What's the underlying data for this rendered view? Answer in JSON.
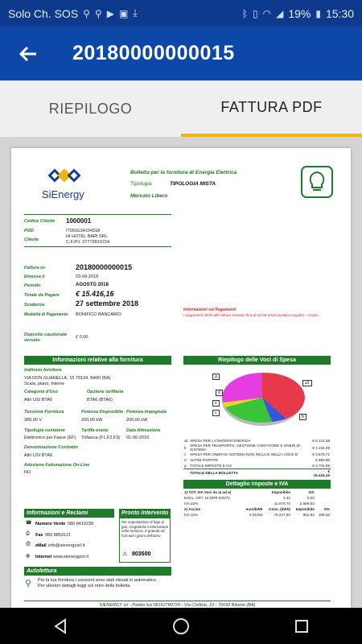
{
  "status": {
    "carrier": "Solo Ch. SOS",
    "battery": "19%",
    "time": "15:30"
  },
  "appbar": {
    "title": "20180000000015"
  },
  "tabs": [
    {
      "label": "RIEPILOGO"
    },
    {
      "label": "FATTURA PDF"
    }
  ],
  "invoice": {
    "brand": "SiEnergy",
    "heading": "Bolletta per la fornitura di Energia Elettrica",
    "tipologia_label": "Tipologia",
    "tipologia_value": "TIPOLOGIA MISTA",
    "mercato": "Mercato Libero",
    "codice_cliente_label": "Codice Cliente",
    "codice_cliente": "1000001",
    "pod_label": "POD",
    "pod": "IT001E34104318",
    "cliente_label": "Cliente",
    "cliente_name": "HI HOTEL BARI SRL",
    "cliente_cf": "C.F./P.I. 07779910724",
    "fattura_label": "Fattura nr.",
    "fattura": "20180000000015",
    "emessa_label": "Emessa il",
    "emessa": "03-09-2018",
    "periodo_label": "Periodo",
    "periodo": "AGOSTO 2018",
    "totale_label": "Totale da Pagare",
    "totale": "€ 15.416,16",
    "scadenza_label": "Scadenza",
    "scadenza": "27 settembre 2018",
    "modalita_label": "Modalità di Pagamento",
    "modalita": "BONIFICO BANCARIO",
    "info_pagamenti_label": "Informazioni sui Pagamenti",
    "info_pagamenti": "I pagamenti riferiti alle fatture emesse fino al 03-09-2018 risultano regolari - Grazie",
    "deposito_label": "Deposito cauzionale versato",
    "deposito": "€  0,00",
    "fornitura_bar": "Informazioni relative alla fornitura",
    "indirizzo_label": "Indirizzo fornitura",
    "indirizzo": "VIA DON GUANELLA, 15 70124, BARI (BA)",
    "indirizzo2": "Scala, piano, interno",
    "categoria_label": "Categoria d'Uso",
    "categoria": "Altri USI BTA6",
    "opzione_label": "Opzione tariffaria",
    "opzione": "BTA6 (BTA6)",
    "tensione_label": "Tensione Fornitura",
    "tensione": "380,00   V",
    "potdisp_label": "Potenza Disponibile",
    "potdisp": "200,00    kW",
    "potimp_label": "Potenza impegnata",
    "potimp": "200,00   kW",
    "contatore_label": "Tipologia contatore",
    "contatore": "Elettronico per Fasce (EF)",
    "tariffa_label": "Tariffa oraria",
    "tariffa": "Trifascia (F1,F2,F3)",
    "attivazione_label": "Data Attivazione",
    "attivazione": "01-06-2016",
    "denominazione_label": "Denominazione Contratto",
    "denominazione": "Altri USI BTA6",
    "adesione_label": "Adesione Fatturazione On-Line",
    "adesione": "NO",
    "riepilogo_bar": "Riepilogo delle Voci di Spesa",
    "pie_labels": [
      "a1",
      "b",
      "c",
      "d",
      "e",
      "g"
    ],
    "voci": [
      {
        "k": "a1",
        "label": "SPESA PER LA MATERIA ENERGIA",
        "v": "€ 6.121,58"
      },
      {
        "k": "b",
        "label": "SPESA PER TRASPORTO, GESTIONE CONTATORE E ONERI DI SISTEMA",
        "v": "€ 1.232,69"
      },
      {
        "k": "c",
        "label": "SPESA PER ONERI DI SISTEMA NON INCLUSI NELLA VOCE B",
        "v": "€ 3.678,71"
      },
      {
        "k": "d",
        "label": "ALTRE PARTITE",
        "v": "€ 650,99"
      },
      {
        "k": "g",
        "label": "TOTALE IMPOSTE E IVA",
        "v": "€ 3.731,99"
      },
      {
        "k": "",
        "label": "TOTALE DELLA BOLLETTA",
        "v": "€ 15.416,16"
      }
    ],
    "imposte_bar": "Dettaglio Imposte e IVA",
    "imposte_rows": [
      [
        "1) TOT. IVA Voci da a) ad e)",
        "",
        "Imponibile",
        "IVA"
      ],
      [
        "ESCL. ART. 15 DPR 633/72",
        "",
        "4,42",
        "0,00"
      ],
      [
        "IVA 22%",
        "",
        "11.679,75",
        "2.569,53"
      ],
      [
        "2) Accise",
        "euro/kWh",
        "Cons. (kWh)",
        "Imponibile",
        "IVA"
      ],
      [
        "IVA 22%",
        "0,01250",
        "76.227,00",
        "952,84",
        "209,62"
      ]
    ],
    "reclami_bar": "Informazioni e Reclami",
    "numero_verde_label": "Numero Verde",
    "numero_verde": "080 8410239",
    "fax_label": "Fax",
    "fax": "080 8853121",
    "email_label": "eMail",
    "email": "info@sienergysrl.it",
    "internet_label": "Internet",
    "internet": "www.sienergysrl.it",
    "pronto_bar": "Pronto Intervento",
    "pronto_text": "Per segnalazione di fuga di gas, irregolarità o interruzione nella fornitura, è gratuito ed h24 tutti i giorni dell'anno.",
    "pronto_num": "803500",
    "autolettura_bar": "Autolettura",
    "autolettura_text1": "Per la tua fornitura i consumi sono stati rilevati in automatico.",
    "autolettura_text2": "Per ulteriori dettagli leggi sul retro della bolletta.",
    "footer": "SIENERGY srl - Partita Iva 08162780729 - Via Civilizio, 23 - 70032 Bitonto (BA)"
  }
}
